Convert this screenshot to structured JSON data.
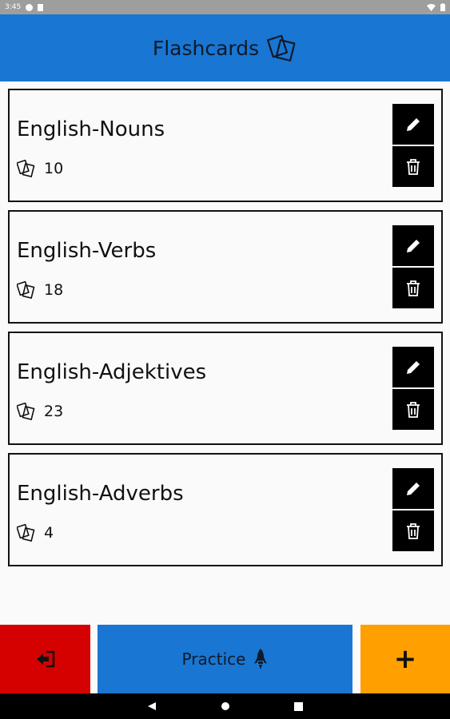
{
  "status_bar": {
    "time": "3:45"
  },
  "app_bar": {
    "title": "Flashcards"
  },
  "decks": [
    {
      "name": "English-Nouns",
      "count": "10"
    },
    {
      "name": "English-Verbs",
      "count": "18"
    },
    {
      "name": "English-Adjektives",
      "count": "23"
    },
    {
      "name": "English-Adverbs",
      "count": "4"
    }
  ],
  "bottom_bar": {
    "practice_label": "Practice",
    "add_label": "+"
  },
  "icons": {
    "deck": "cards-icon",
    "edit": "pencil-icon",
    "delete": "trash-icon",
    "exit": "logout-icon",
    "practice": "rocket-icon"
  },
  "colors": {
    "primary": "#1976d2",
    "exit": "#d50000",
    "add": "#ffa000",
    "action_bg": "#000000"
  }
}
